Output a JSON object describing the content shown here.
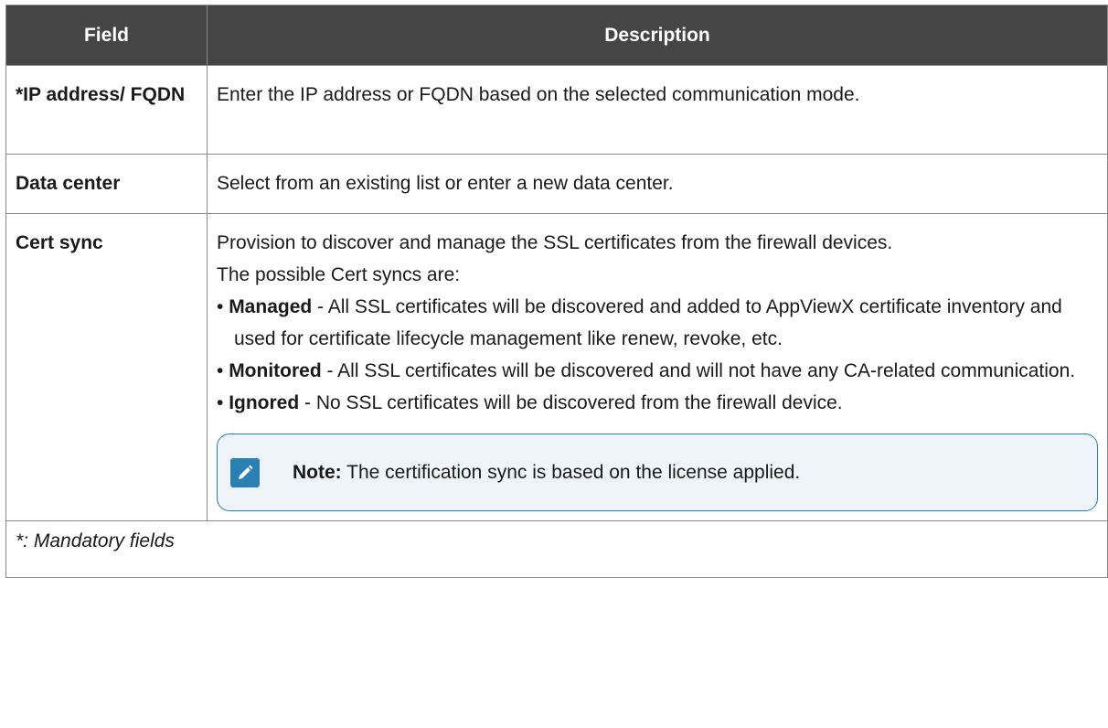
{
  "table": {
    "headers": [
      "Field",
      "Description"
    ],
    "rows": [
      {
        "field": "*IP address/ FQDN",
        "description": "Enter the IP address or FQDN based on the selected communication mode."
      },
      {
        "field": "Data center",
        "description": "Select from an existing list or enter a new data center."
      },
      {
        "field": "Cert sync",
        "intro1": "Provision to discover and manage the SSL certificates from the firewall devices.",
        "intro2": "The possible Cert syncs are:",
        "bullets": [
          {
            "term": "Managed",
            "text": " - All SSL certificates will be discovered and added to AppViewX certificate inventory and used for certificate lifecycle management like renew, revoke, etc."
          },
          {
            "term": "Monitored",
            "text": " - All SSL certificates will be discovered and will not have any CA-related communication."
          },
          {
            "term": "Ignored",
            "text": " - No SSL certificates will be discovered from the firewall device."
          }
        ],
        "note": {
          "icon": "pencil-icon",
          "label": "Note:",
          "text": " The certification sync is based on the license applied."
        }
      }
    ],
    "footer": "*: Mandatory fields"
  },
  "colors": {
    "header_bg": "#454545",
    "note_border": "#2a7fb3",
    "note_bg": "#eef4f9"
  }
}
